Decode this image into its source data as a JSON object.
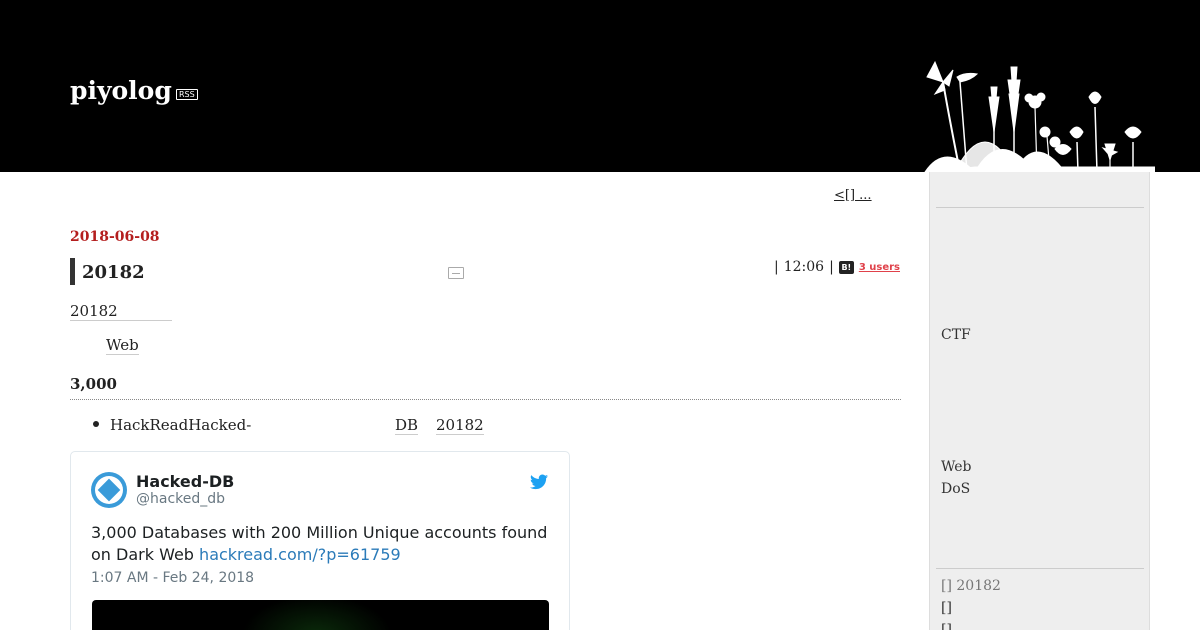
{
  "header": {
    "blog_title": "piyolog",
    "rss_label": "RSS"
  },
  "pager": {
    "prev_label": "<[] ...      "
  },
  "entry": {
    "date": "2018-06-08",
    "title": "20182",
    "time_prefix": "|",
    "time": "12:06",
    "time_suffix": "|",
    "hatena_bookmark_icon": "B!",
    "bookmark_users": "3 users",
    "line1": "20182",
    "line2": "Web",
    "section_heading": "3,000",
    "bullet_text": "HackReadHacked-",
    "bullet_db": "DB",
    "bullet_year": "20182"
  },
  "tweet": {
    "name": "Hacked-DB",
    "handle": "@hacked_db",
    "text": "3,000 Databases with 200 Million Unique accounts found on Dark Web ",
    "link": "hackread.com/?p=61759",
    "timestamp": "1:07 AM - Feb 24, 2018",
    "icon": "twitter-bird-icon"
  },
  "sidebar": {
    "item_ctf": "CTF",
    "item_web": "Web",
    "item_dos": "DoS",
    "recent_1": "[] 20182",
    "recent_2": "[]",
    "recent_3": "[]"
  },
  "colors": {
    "header_bg": "#000000",
    "date_red": "#b41e1e",
    "sidebar_bg": "#eeeeee",
    "tweet_link": "#2b7bb9",
    "bookmark_red": "#e0414a"
  }
}
